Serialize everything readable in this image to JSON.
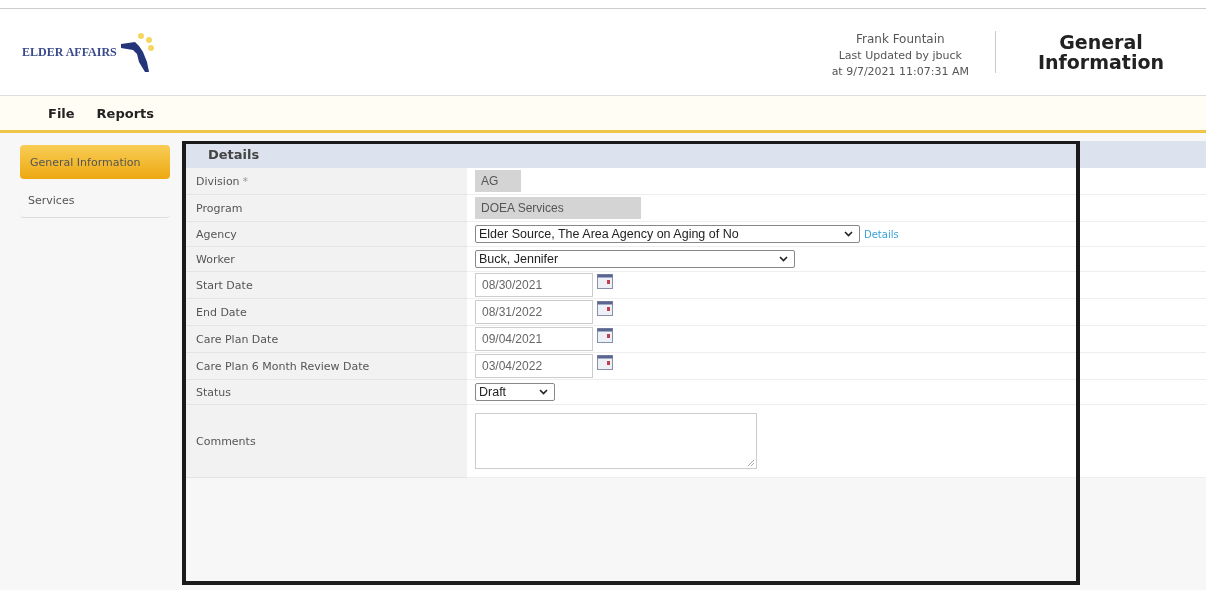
{
  "logo": {
    "text": "ELDER AFFAIRS"
  },
  "header": {
    "client": "Frank Fountain",
    "updated_by": "Last Updated by jbuck",
    "updated_at": "at 9/7/2021 11:07:31 AM",
    "page_title": "General Information"
  },
  "menu": [
    "File",
    "Reports"
  ],
  "sidebar": {
    "items": [
      {
        "label": "General Information",
        "selected": true
      },
      {
        "label": "Services",
        "selected": false
      }
    ]
  },
  "details": {
    "title": "Details",
    "fields": [
      {
        "label": "Division",
        "mark": "*",
        "kind": "readonly",
        "value": "AG"
      },
      {
        "label": "Program",
        "kind": "readonly",
        "value": "DOEA Services"
      },
      {
        "label": "Agency",
        "kind": "select",
        "value": "Elder Source, The Area Agency on Aging of No",
        "link": "Details"
      },
      {
        "label": "Worker",
        "kind": "select",
        "value": "Buck, Jennifer"
      },
      {
        "label": "Start Date",
        "kind": "date",
        "value": "08/30/2021"
      },
      {
        "label": "End Date",
        "kind": "date",
        "value": "08/31/2022"
      },
      {
        "label": "Care Plan Date",
        "kind": "date",
        "value": "09/04/2021"
      },
      {
        "label": "Care Plan 6 Month Review Date",
        "kind": "date",
        "value": "03/04/2022"
      },
      {
        "label": "Status",
        "kind": "select",
        "value": "Draft"
      },
      {
        "label": "Comments",
        "kind": "textarea"
      }
    ]
  }
}
